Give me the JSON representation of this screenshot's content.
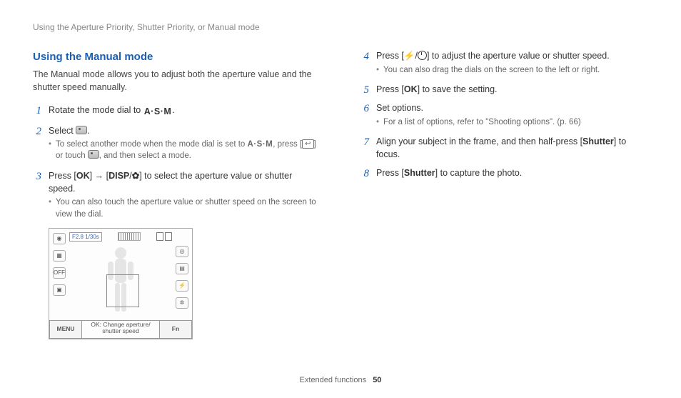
{
  "breadcrumb": "Using the Aperture Priority, Shutter Priority, or Manual mode",
  "title": "Using the Manual mode",
  "intro": "The Manual mode allows you to adjust both the aperture value and the shutter speed manually.",
  "steps": {
    "s1": {
      "n": "1",
      "pre": "Rotate the mode dial to ",
      "icon": "A·S·M",
      "post": "."
    },
    "s2": {
      "n": "2",
      "pre": "Select ",
      "post": ".",
      "sub_a": "To select another mode when the mode dial is set to ",
      "sub_b": ", press [",
      "sub_c": "] or touch ",
      "sub_d": ", and then select a mode."
    },
    "s3": {
      "n": "3",
      "pre": "Press [",
      "mid1": "] → [",
      "mid2": "/",
      "post": "] to select the aperture value or shutter speed.",
      "sub": "You can also touch the aperture value or shutter speed on the screen to view the dial."
    },
    "s4": {
      "n": "4",
      "pre": "Press [",
      "mid": "/",
      "post": "] to adjust the aperture value or shutter speed.",
      "sub": "You can also drag the dials on the screen to the left or right."
    },
    "s5": {
      "n": "5",
      "pre": "Press [",
      "post": "] to save the setting."
    },
    "s6": {
      "n": "6",
      "txt": "Set options.",
      "sub": "For a list of options, refer to \"Shooting options\". (p. 66)"
    },
    "s7": {
      "n": "7",
      "pre": "Align your subject in the frame, and then half-press [",
      "btn": "Shutter",
      "post": "] to focus."
    },
    "s8": {
      "n": "8",
      "pre": "Press [",
      "btn": "Shutter",
      "post": "] to capture the photo."
    }
  },
  "labels": {
    "ok": "OK",
    "disp": "DISP",
    "asm": "A·S·M",
    "back": "↩"
  },
  "lcd": {
    "fstop": "F2.8 1/30s",
    "menu": "MENU",
    "fn": "Fn",
    "hint": "OK: Change aperture/ shutter speed"
  },
  "footer": {
    "section": "Extended functions",
    "page": "50"
  }
}
